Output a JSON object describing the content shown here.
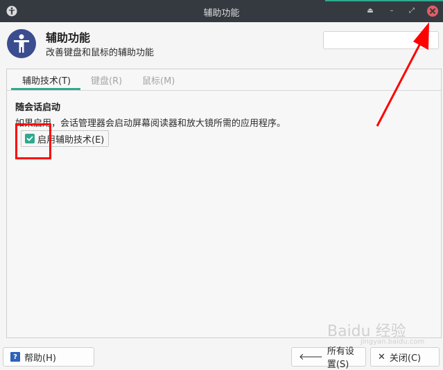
{
  "window": {
    "title": "辅助功能"
  },
  "header": {
    "title": "辅助功能",
    "subtitle": "改善键盘和鼠标的辅助功能",
    "search_placeholder": ""
  },
  "tabs": [
    {
      "label": "辅助技术(T)",
      "active": true
    },
    {
      "label": "键盘(R)",
      "active": false
    },
    {
      "label": "鼠标(M)",
      "active": false
    }
  ],
  "section": {
    "title": "随会话启动",
    "description": "如果启用，会话管理器会启动屏幕阅读器和放大镜所需的应用程序。",
    "checkbox_label": "启用辅助技术(E)",
    "checkbox_checked": true
  },
  "footer": {
    "help_label": "帮助(H)",
    "all_settings_label": "所有设置(S)",
    "close_label": "关闭(C)"
  },
  "watermark": {
    "text": "Baidu 经验",
    "sub": "jingyan.baidu.com"
  },
  "colors": {
    "titlebar_bg": "#343a40",
    "accent": "#2fa98f",
    "close_button": "#e05d65",
    "annotation_red": "#ff0000",
    "icon_blue": "#3a4d8f"
  },
  "icons": {
    "app": "accessibility-icon",
    "window_shade": "eject-icon",
    "minimize": "minimize-icon",
    "maximize": "maximize-icon",
    "close": "close-icon",
    "help": "help-icon",
    "all_settings": "arrow-left-icon",
    "close_button": "x-icon"
  }
}
